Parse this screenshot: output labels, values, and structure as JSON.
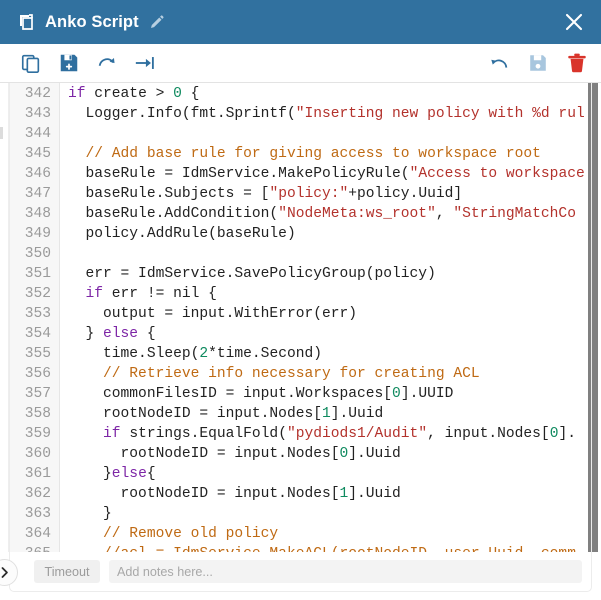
{
  "window": {
    "title": "Anko Script",
    "title_icon": "script-icon",
    "edit_icon": "pencil-icon",
    "close_icon": "close-icon",
    "titlebar_color": "#31719f"
  },
  "toolbar": {
    "left_buttons": [
      {
        "name": "copy-button",
        "icon": "copy-icon",
        "color": "#2f6f9f"
      },
      {
        "name": "save-as-button",
        "icon": "floppy-plus-icon",
        "color": "#2f6f9f"
      },
      {
        "name": "reload-button",
        "icon": "redo-arrow-icon",
        "color": "#2f6f9f"
      },
      {
        "name": "indent-button",
        "icon": "tab-indent-icon",
        "color": "#2f6f9f"
      }
    ],
    "right_buttons": [
      {
        "name": "undo-button",
        "icon": "undo-arrow-icon",
        "color": "#2f6f9f"
      },
      {
        "name": "save-button",
        "icon": "floppy-icon",
        "color": "#a8c6de"
      },
      {
        "name": "delete-button",
        "icon": "trash-icon",
        "color": "#d9342b"
      }
    ]
  },
  "editor": {
    "first_line_number": 342,
    "lines": [
      {
        "n": 342,
        "tokens": [
          {
            "t": "if ",
            "c": "kw"
          },
          {
            "t": "create > ",
            "c": "pl"
          },
          {
            "t": "0",
            "c": "num"
          },
          {
            "t": " {",
            "c": "pl"
          }
        ]
      },
      {
        "n": 343,
        "tokens": [
          {
            "t": "  Logger.Info(fmt.Sprintf(",
            "c": "pl"
          },
          {
            "t": "\"Inserting new policy with %d rul",
            "c": "str"
          }
        ]
      },
      {
        "n": 344,
        "tokens": [
          {
            "t": "",
            "c": "pl"
          }
        ]
      },
      {
        "n": 345,
        "tokens": [
          {
            "t": "  // Add base rule for giving access to workspace root",
            "c": "cmt"
          }
        ]
      },
      {
        "n": 346,
        "tokens": [
          {
            "t": "  baseRule = IdmService.MakePolicyRule(",
            "c": "pl"
          },
          {
            "t": "\"Access to workspace",
            "c": "str"
          }
        ]
      },
      {
        "n": 347,
        "tokens": [
          {
            "t": "  baseRule.Subjects = [",
            "c": "pl"
          },
          {
            "t": "\"policy:\"",
            "c": "str"
          },
          {
            "t": "+policy.Uuid]",
            "c": "pl"
          }
        ]
      },
      {
        "n": 348,
        "tokens": [
          {
            "t": "  baseRule.AddCondition(",
            "c": "pl"
          },
          {
            "t": "\"NodeMeta:ws_root\"",
            "c": "str"
          },
          {
            "t": ", ",
            "c": "pl"
          },
          {
            "t": "\"StringMatchCo",
            "c": "str"
          }
        ]
      },
      {
        "n": 349,
        "tokens": [
          {
            "t": "  policy.AddRule(baseRule)",
            "c": "pl"
          }
        ]
      },
      {
        "n": 350,
        "tokens": [
          {
            "t": "",
            "c": "pl"
          }
        ]
      },
      {
        "n": 351,
        "tokens": [
          {
            "t": "  err = IdmService.SavePolicyGroup(policy)",
            "c": "pl"
          }
        ]
      },
      {
        "n": 352,
        "tokens": [
          {
            "t": "  ",
            "c": "pl"
          },
          {
            "t": "if ",
            "c": "kw"
          },
          {
            "t": "err != nil {",
            "c": "pl"
          }
        ]
      },
      {
        "n": 353,
        "tokens": [
          {
            "t": "    output = input.WithError(err)",
            "c": "pl"
          }
        ]
      },
      {
        "n": 354,
        "tokens": [
          {
            "t": "  } ",
            "c": "pl"
          },
          {
            "t": "else",
            "c": "kw"
          },
          {
            "t": " {",
            "c": "pl"
          }
        ]
      },
      {
        "n": 355,
        "tokens": [
          {
            "t": "    time.Sleep(",
            "c": "pl"
          },
          {
            "t": "2",
            "c": "num"
          },
          {
            "t": "*time.Second)",
            "c": "pl"
          }
        ]
      },
      {
        "n": 356,
        "tokens": [
          {
            "t": "    // Retrieve info necessary for creating ACL",
            "c": "cmt"
          }
        ]
      },
      {
        "n": 357,
        "tokens": [
          {
            "t": "    commonFilesID = input.Workspaces[",
            "c": "pl"
          },
          {
            "t": "0",
            "c": "num"
          },
          {
            "t": "].UUID",
            "c": "pl"
          }
        ]
      },
      {
        "n": 358,
        "tokens": [
          {
            "t": "    rootNodeID = input.Nodes[",
            "c": "pl"
          },
          {
            "t": "1",
            "c": "num"
          },
          {
            "t": "].Uuid",
            "c": "pl"
          }
        ]
      },
      {
        "n": 359,
        "tokens": [
          {
            "t": "    ",
            "c": "pl"
          },
          {
            "t": "if ",
            "c": "kw"
          },
          {
            "t": "strings.EqualFold(",
            "c": "pl"
          },
          {
            "t": "\"pydiods1/Audit\"",
            "c": "str"
          },
          {
            "t": ", input.Nodes[",
            "c": "pl"
          },
          {
            "t": "0",
            "c": "num"
          },
          {
            "t": "].",
            "c": "pl"
          }
        ]
      },
      {
        "n": 360,
        "tokens": [
          {
            "t": "      rootNodeID = input.Nodes[",
            "c": "pl"
          },
          {
            "t": "0",
            "c": "num"
          },
          {
            "t": "].Uuid",
            "c": "pl"
          }
        ]
      },
      {
        "n": 361,
        "tokens": [
          {
            "t": "    }",
            "c": "pl"
          },
          {
            "t": "else",
            "c": "kw"
          },
          {
            "t": "{",
            "c": "pl"
          }
        ]
      },
      {
        "n": 362,
        "tokens": [
          {
            "t": "      rootNodeID = input.Nodes[",
            "c": "pl"
          },
          {
            "t": "1",
            "c": "num"
          },
          {
            "t": "].Uuid",
            "c": "pl"
          }
        ]
      },
      {
        "n": 363,
        "tokens": [
          {
            "t": "    }",
            "c": "pl"
          }
        ]
      },
      {
        "n": 364,
        "tokens": [
          {
            "t": "    // Remove old policy",
            "c": "cmt"
          }
        ]
      },
      {
        "n": 365,
        "tokens": [
          {
            "t": "    //acl = IdmService.MakeACL(rootNodeID, user.Uuid, comm",
            "c": "cmt"
          }
        ]
      }
    ],
    "vertical_scrollbar": "vertical-scrollbar"
  },
  "bottombar": {
    "collapse_icon": "chevron-right-icon",
    "timeout_label": "Timeout",
    "notes_placeholder": "Add notes here..."
  }
}
